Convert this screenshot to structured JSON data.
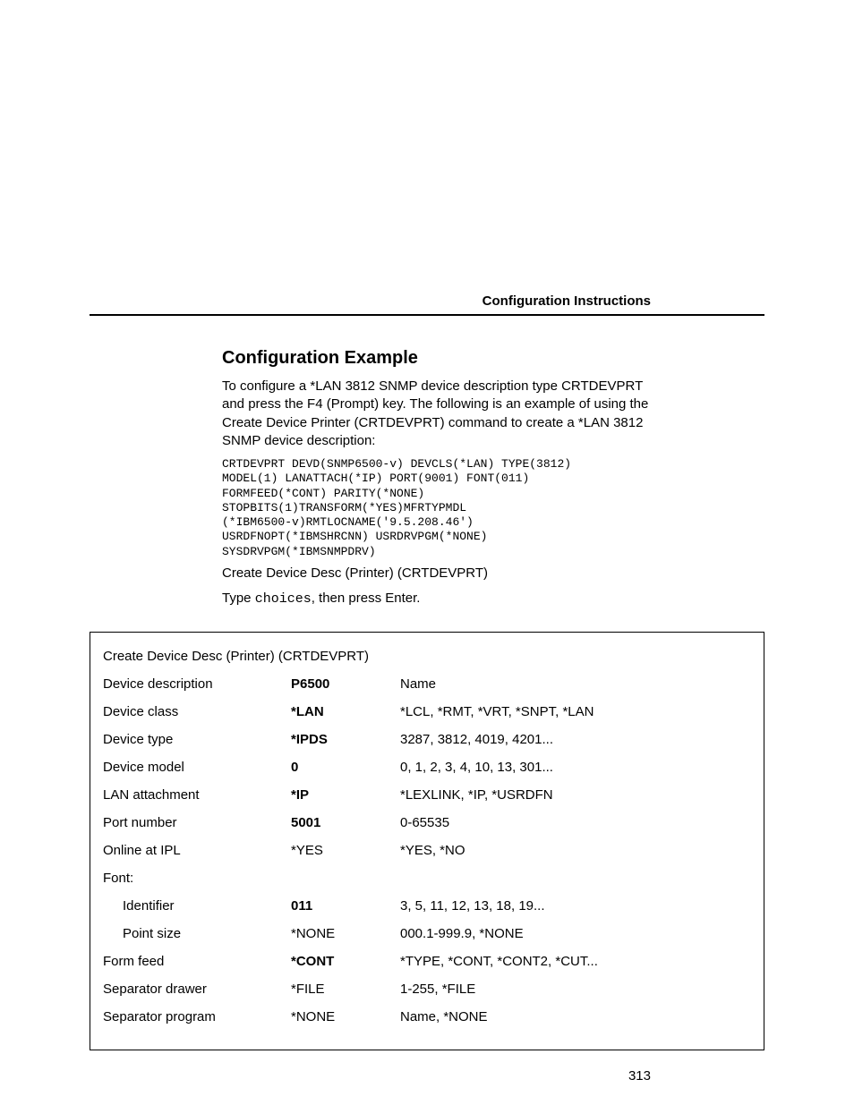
{
  "header": {
    "label": "Configuration Instructions"
  },
  "section": {
    "title": "Configuration Example",
    "intro": "To configure a *LAN 3812 SNMP device description type CRTDEVPRT and press the F4 (Prompt) key. The following is an example of using the Create Device Printer (CRTDEVPRT) command to create a *LAN 3812 SNMP device description:",
    "code": "CRTDEVPRT DEVD(SNMP6500-v) DEVCLS(*LAN) TYPE(3812)\nMODEL(1) LANATTACH(*IP) PORT(9001) FONT(011)\nFORMFEED(*CONT) PARITY(*NONE)\nSTOPBITS(1)TRANSFORM(*YES)MFRTYPMDL\n(*IBM6500-v)RMTLOCNAME('9.5.208.46')\nUSRDFNOPT(*IBMSHRCNN) USRDRVPGM(*NONE)\nSYSDRVPGM(*IBMSNMPDRV)",
    "post_code1": "Create Device Desc (Printer) (CRTDEVPRT)",
    "type_prefix": "Type ",
    "type_code": "choices",
    "type_suffix": ", then press Enter."
  },
  "table": {
    "title": "Create Device Desc (Printer) (CRTDEVPRT)",
    "rows": [
      {
        "label": "Device description",
        "value": "P6500",
        "bold": true,
        "hint": "Name",
        "indent": false
      },
      {
        "label": "Device class",
        "value": "*LAN",
        "bold": true,
        "hint": "*LCL, *RMT, *VRT, *SNPT, *LAN",
        "indent": false
      },
      {
        "label": "Device type",
        "value": "*IPDS",
        "bold": true,
        "hint": "3287, 3812, 4019, 4201...",
        "indent": false
      },
      {
        "label": "Device model",
        "value": "0",
        "bold": true,
        "hint": "0, 1, 2, 3, 4, 10, 13, 301...",
        "indent": false
      },
      {
        "label": "LAN attachment",
        "value": "*IP",
        "bold": true,
        "hint": "*LEXLINK, *IP, *USRDFN",
        "indent": false
      },
      {
        "label": "Port number",
        "value": "5001",
        "bold": true,
        "hint": "0-65535",
        "indent": false
      },
      {
        "label": "Online at IPL",
        "value": "*YES",
        "bold": false,
        "hint": "*YES, *NO",
        "indent": false
      },
      {
        "label": "Font:",
        "value": "",
        "bold": false,
        "hint": "",
        "indent": false
      },
      {
        "label": "Identifier",
        "value": "011",
        "bold": true,
        "hint": "3, 5, 11, 12, 13, 18, 19...",
        "indent": true
      },
      {
        "label": "Point size",
        "value": "*NONE",
        "bold": false,
        "hint": "000.1-999.9, *NONE",
        "indent": true
      },
      {
        "label": "Form feed",
        "value": "*CONT",
        "bold": true,
        "hint": "*TYPE, *CONT, *CONT2, *CUT...",
        "indent": false
      },
      {
        "label": "Separator drawer",
        "value": "*FILE",
        "bold": false,
        "hint": "1-255, *FILE",
        "indent": false
      },
      {
        "label": "Separator program",
        "value": "*NONE",
        "bold": false,
        "hint": "Name, *NONE",
        "indent": false
      }
    ]
  },
  "page_number": "313"
}
